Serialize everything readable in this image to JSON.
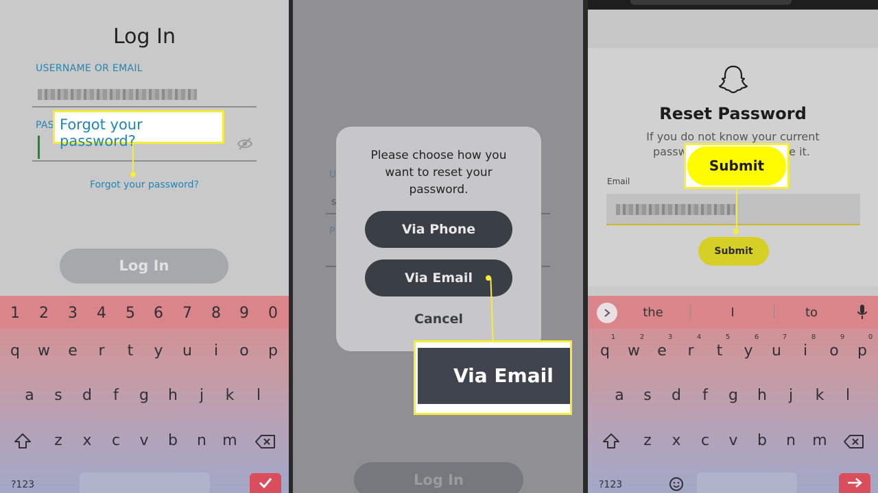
{
  "panel1": {
    "title": "Log In",
    "username_label": "USERNAME OR EMAIL",
    "password_label": "PAS",
    "forgot_small": "Forgot your password?",
    "login_button": "Log In",
    "callout_text": "Forgot your password?"
  },
  "panel2": {
    "bg_labels": [
      "U",
      "s",
      "P"
    ],
    "modal_prompt_lines": [
      "Please choose how you",
      "want to reset your",
      "password."
    ],
    "via_phone": "Via Phone",
    "via_email": "Via Email",
    "cancel": "Cancel",
    "login_button": "Log In",
    "callout_text": "Via Email"
  },
  "panel3": {
    "title": "Reset Password",
    "desc_line1": "If you do not know your current",
    "desc_line2a": "passw",
    "desc_line2b": "ge it.",
    "email_label": "Email",
    "submit_button": "Submit",
    "callout_text": "Submit",
    "suggestions": [
      "the",
      "I",
      "to"
    ]
  },
  "keyboard": {
    "numbers": [
      "1",
      "2",
      "3",
      "4",
      "5",
      "6",
      "7",
      "8",
      "9",
      "0"
    ],
    "row1": [
      "q",
      "w",
      "e",
      "r",
      "t",
      "y",
      "u",
      "i",
      "o",
      "p"
    ],
    "row2": [
      "a",
      "s",
      "d",
      "f",
      "g",
      "h",
      "j",
      "k",
      "l"
    ],
    "row3": [
      "z",
      "x",
      "c",
      "v",
      "b",
      "n",
      "m"
    ],
    "symbols_key": "?123"
  },
  "colors": {
    "callout_border": "#f6ec3a",
    "link_blue": "#1f86b8",
    "snap_yellow": "#fffc00",
    "dark_button": "#3a3f45"
  }
}
